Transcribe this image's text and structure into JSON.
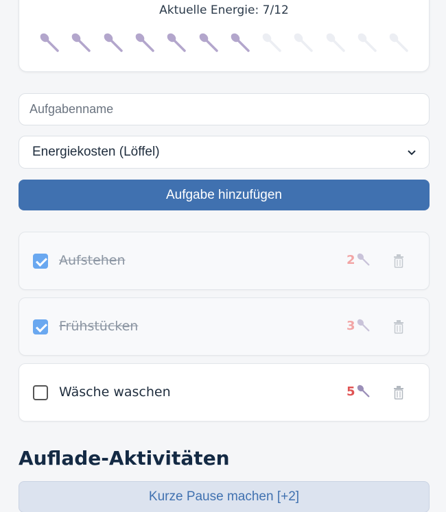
{
  "energy": {
    "label": "Aktuelle Energie: 7/12",
    "current": 7,
    "max": 12,
    "spoon_icon": "spoon-icon",
    "active_color": "#b3a6cc",
    "inactive_color": "#eceef3"
  },
  "form": {
    "name_placeholder": "Aufgabenname",
    "cost_selected": "Energiekosten (Löffel)",
    "add_label": "Aufgabe hinzufügen"
  },
  "tasks": [
    {
      "name": "Aufstehen",
      "cost": "2",
      "done": true
    },
    {
      "name": "Frühstücken",
      "cost": "3",
      "done": true
    },
    {
      "name": "Wäsche waschen",
      "cost": "5",
      "done": false
    }
  ],
  "recharge": {
    "title": "Auflade-Aktivitäten",
    "items": [
      {
        "label": "Kurze Pause machen [+2]"
      }
    ]
  },
  "colors": {
    "primary": "#4071b0",
    "cost_red": "#e05454"
  }
}
